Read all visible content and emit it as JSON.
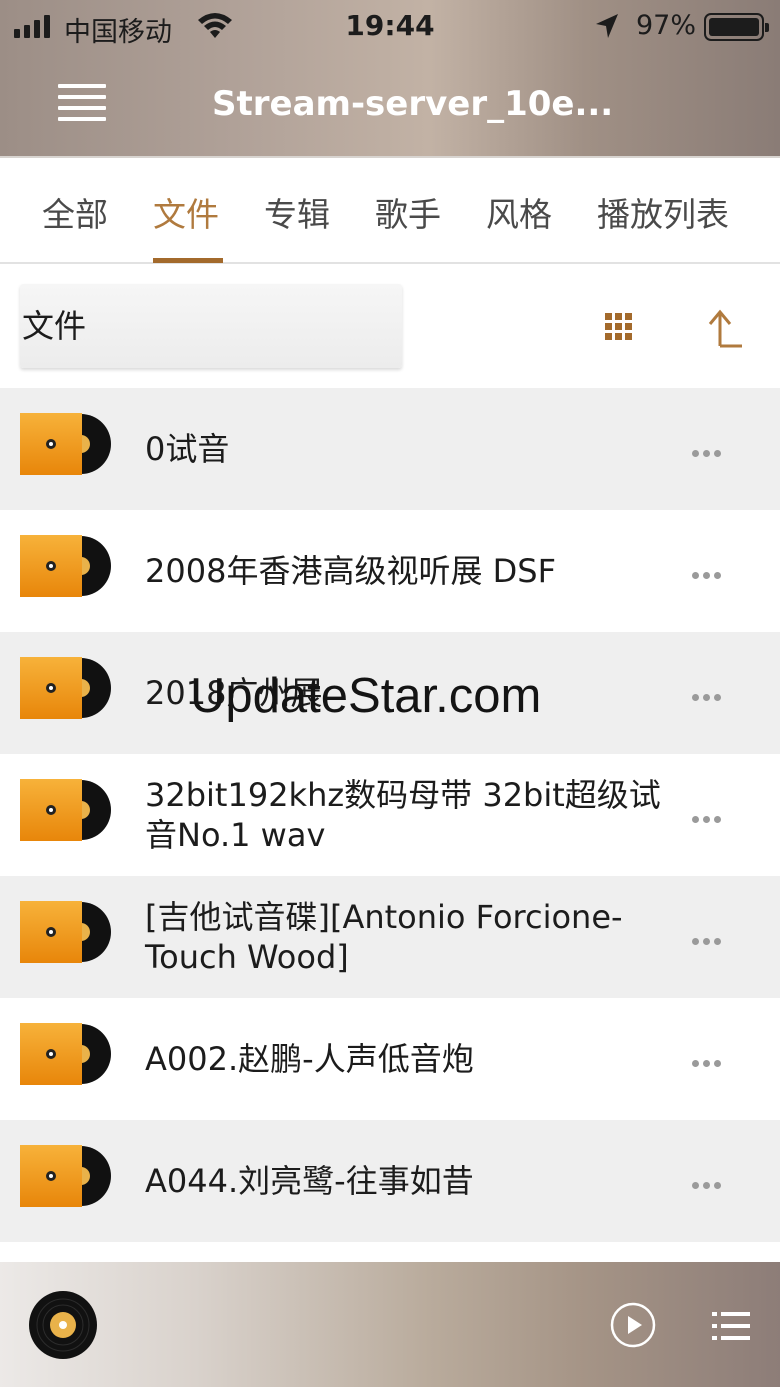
{
  "status_bar": {
    "carrier": "中国移动",
    "time": "19:44",
    "battery": "97%"
  },
  "header": {
    "title": "Stream-server_10e..."
  },
  "tabs": [
    {
      "label": "全部",
      "active": false
    },
    {
      "label": "文件",
      "active": true
    },
    {
      "label": "专辑",
      "active": false
    },
    {
      "label": "歌手",
      "active": false
    },
    {
      "label": "风格",
      "active": false
    },
    {
      "label": "播放列表",
      "active": false
    }
  ],
  "path": {
    "label": "文件"
  },
  "items": [
    {
      "label": "0试音"
    },
    {
      "label": "2008年香港高级视听展  DSF"
    },
    {
      "label": "2018广州展"
    },
    {
      "label": "32bit192khz数码母带 32bit超级试音No.1 wav"
    },
    {
      "label": "[吉他试音碟][Antonio Forcione-Touch Wood]"
    },
    {
      "label": "A002.赵鹏-人声低音炮"
    },
    {
      "label": "A044.刘亮鹭-往事如昔"
    }
  ],
  "watermark": "UpdateStar.com",
  "colors": {
    "accent": "#b07a3e",
    "underline": "#a36a2c",
    "folder_orange": "#f5a623"
  },
  "icons": {
    "menu": "hamburger-icon",
    "grid": "grid-view-icon",
    "up": "up-arrow-icon",
    "item": "vinyl-folder-icon",
    "more": "more-dots-icon",
    "play": "play-icon",
    "queue": "playlist-icon"
  }
}
